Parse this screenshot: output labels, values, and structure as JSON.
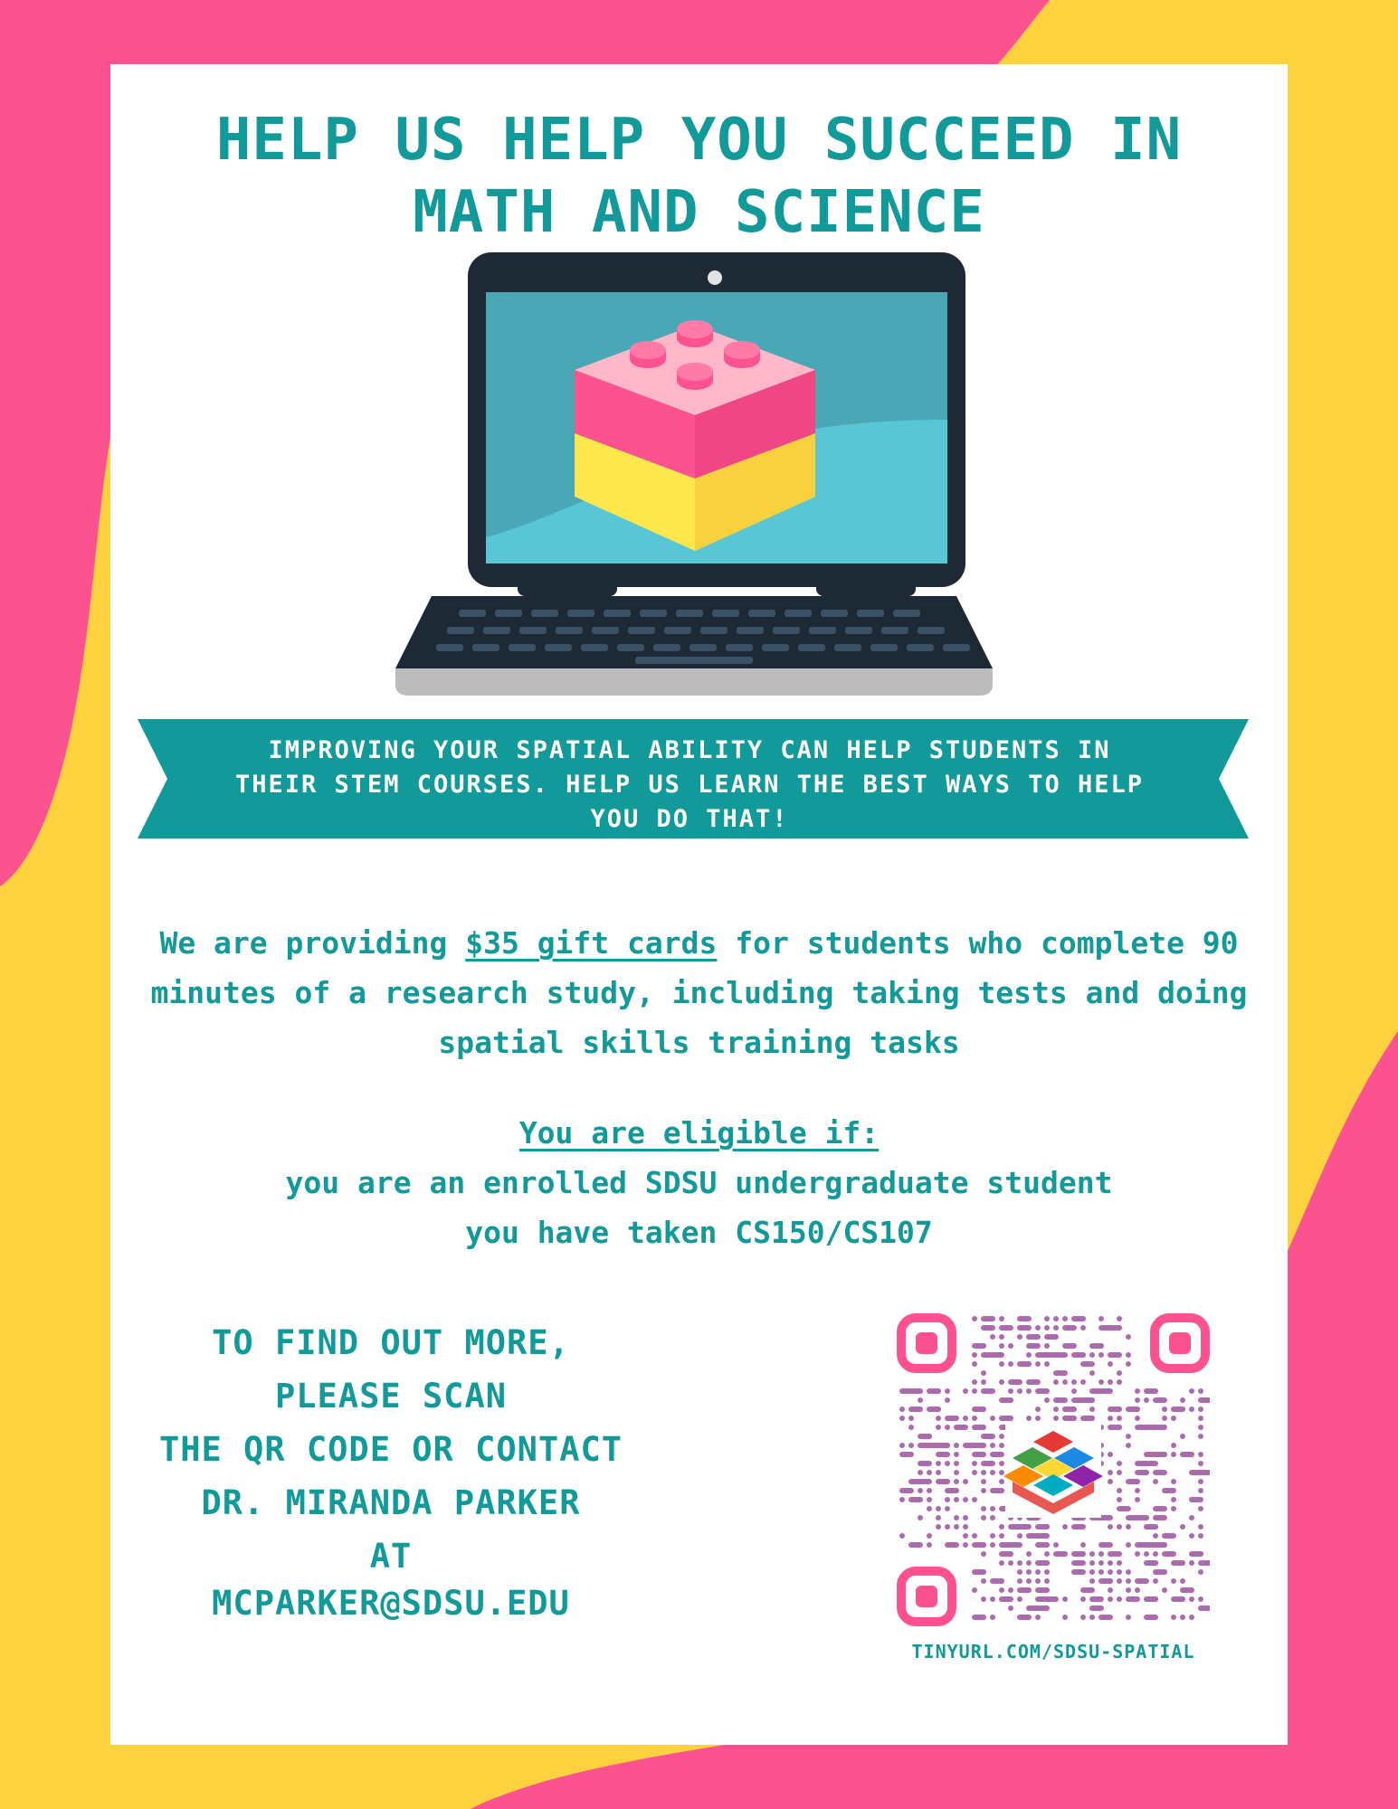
{
  "colors": {
    "pink": "#fd5290",
    "yellow": "#fdd23e",
    "teal": "#12999a",
    "white": "#ffffff"
  },
  "title": {
    "line1": "HELP US HELP YOU SUCCEED IN",
    "line2": "MATH AND SCIENCE"
  },
  "illustration": {
    "icon": "laptop-with-toy-brick-icon"
  },
  "banner": {
    "text": "IMPROVING YOUR SPATIAL ABILITY CAN HELP STUDENTS IN THEIR STEM COURSES. HELP US LEARN THE BEST WAYS TO HELP YOU DO THAT!"
  },
  "offer": {
    "prefix": "We are providing ",
    "highlight": "$35 gift cards",
    "suffix": " for students who complete 90 minutes of a research study, including taking tests and doing spatial skills training tasks"
  },
  "eligibility": {
    "heading": "You are eligible if:",
    "items": [
      "you are an enrolled SDSU undergraduate student",
      "you have taken CS150/CS107"
    ]
  },
  "contact": {
    "lines": [
      "TO FIND OUT MORE, PLEASE SCAN",
      "THE QR CODE OR CONTACT",
      "DR. MIRANDA PARKER",
      "AT"
    ],
    "email": "MCPARKER@SDSU.EDU"
  },
  "qr": {
    "icon": "qr-code-icon",
    "url": "TINYURL.COM/SDSU-SPATIAL"
  }
}
